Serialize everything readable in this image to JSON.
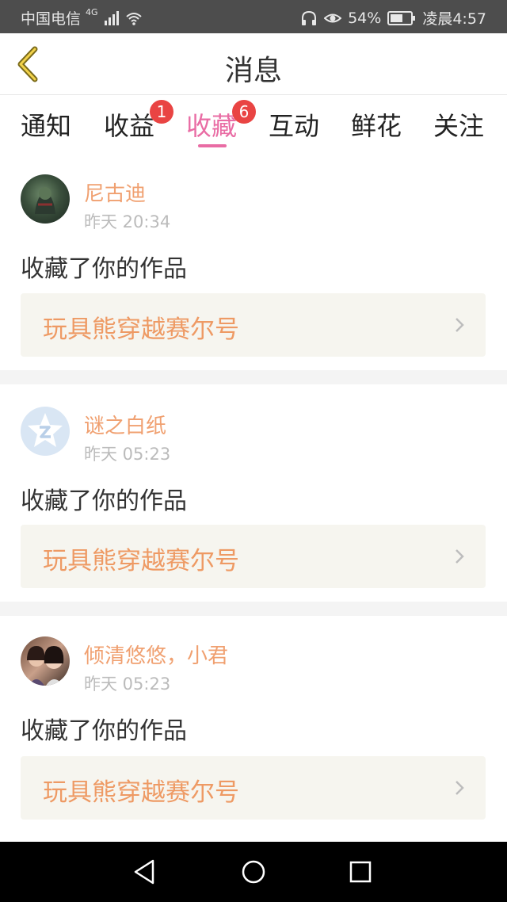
{
  "status_bar": {
    "carrier": "中国电信",
    "network": "4G",
    "battery": "54%",
    "time": "凌晨4:57"
  },
  "header": {
    "title": "消息"
  },
  "tabs": [
    {
      "label": "通知",
      "badge": ""
    },
    {
      "label": "收益",
      "badge": "1"
    },
    {
      "label": "收藏",
      "badge": "6",
      "active": true
    },
    {
      "label": "互动",
      "badge": ""
    },
    {
      "label": "鲜花",
      "badge": ""
    },
    {
      "label": "关注",
      "badge": ""
    }
  ],
  "messages": [
    {
      "username": "尼古迪",
      "time": "昨天 20:34",
      "action": "收藏了你的作品",
      "work_title": "玩具熊穿越赛尔号"
    },
    {
      "username": "谜之白纸",
      "time": "昨天 05:23",
      "action": "收藏了你的作品",
      "work_title": "玩具熊穿越赛尔号"
    },
    {
      "username": "倾清悠悠，小君",
      "time": "昨天 05:23",
      "action": "收藏了你的作品",
      "work_title": "玩具熊穿越赛尔号"
    }
  ],
  "colors": {
    "accent": "#e96ca4",
    "username": "#f0a070",
    "work_title": "#ee9a64",
    "badge": "#e94443"
  }
}
